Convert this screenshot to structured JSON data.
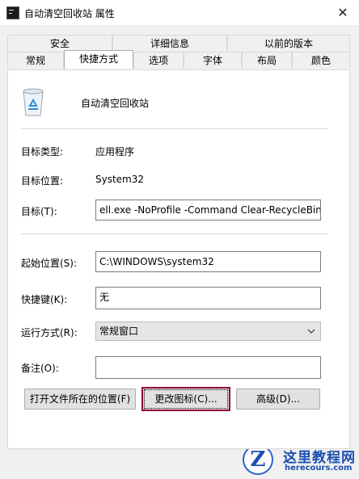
{
  "window": {
    "title": "自动清空回收站 属性",
    "close_glyph": "✕"
  },
  "tabs_row1": [
    "安全",
    "详细信息",
    "以前的版本"
  ],
  "tabs_row2": [
    "常规",
    "快捷方式",
    "选项",
    "字体",
    "布局",
    "颜色"
  ],
  "active_tab": "快捷方式",
  "shortcut": {
    "name": "自动清空回收站",
    "target_type_label": "目标类型:",
    "target_type_value": "应用程序",
    "target_location_label": "目标位置:",
    "target_location_value": "System32",
    "target_label": "目标(T):",
    "target_value": "ell.exe -NoProfile -Command Clear-RecycleBin\"",
    "start_in_label": "起始位置(S):",
    "start_in_value": "C:\\WINDOWS\\system32",
    "hotkey_label": "快捷键(K):",
    "hotkey_value": "无",
    "run_label": "运行方式(R):",
    "run_value": "常规窗口",
    "comment_label": "备注(O):",
    "comment_value": ""
  },
  "buttons": {
    "open_location": "打开文件所在的位置(F)",
    "change_icon": "更改图标(C)...",
    "advanced": "高级(D)..."
  },
  "watermark": {
    "logo_letter": "Z",
    "title": "这里教程网",
    "url": "herecours.com"
  },
  "colors": {
    "focus_border": "#8a0a32",
    "watermark_blue": "#1a4fb0"
  }
}
